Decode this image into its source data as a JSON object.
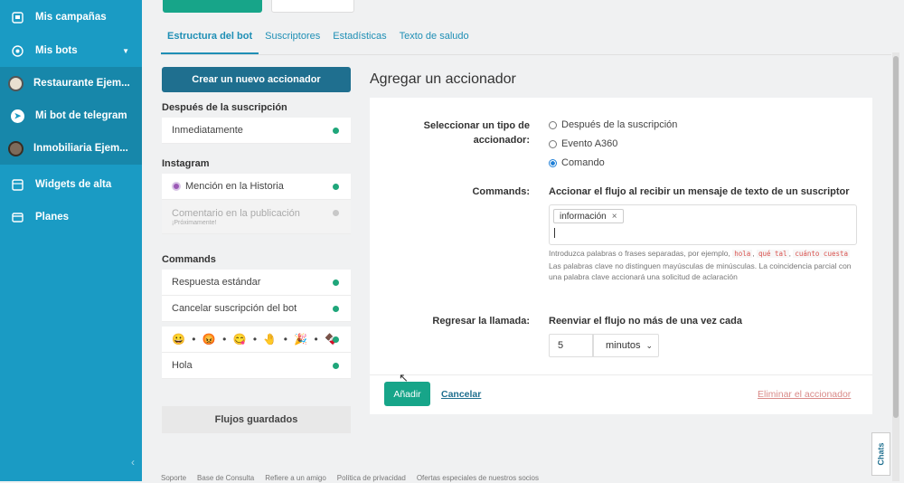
{
  "sidebar": {
    "items": [
      {
        "label": "Mis campañas",
        "icon": "campaigns-icon"
      },
      {
        "label": "Mis bots",
        "icon": "bot-icon"
      },
      {
        "label": "Restaurante Ejem...",
        "icon": "avatar"
      },
      {
        "label": "Mi bot de telegram",
        "icon": "telegram-icon"
      },
      {
        "label": "Inmobiliaria Ejem...",
        "icon": "avatar"
      },
      {
        "label": "Widgets de alta",
        "icon": "widgets-icon"
      },
      {
        "label": "Planes",
        "icon": "plans-icon"
      }
    ]
  },
  "tabs": [
    "Estructura del bot",
    "Suscriptores",
    "Estadísticas",
    "Texto de saludo"
  ],
  "left": {
    "create_label": "Crear un nuevo accionador",
    "sections": [
      {
        "title": "Después de la suscripción",
        "items": [
          "Inmediatamente"
        ]
      },
      {
        "title": "Instagram",
        "items": [
          "Mención en la Historia",
          "Comentario en la publicación",
          "¡Próximamente!"
        ]
      },
      {
        "title": "Commands",
        "items": [
          "Respuesta estándar",
          "Cancelar suscripción del bot",
          "😀 • 😡 • 😋 • 🤚 • 🎉 • 🍫",
          "Hola"
        ]
      }
    ],
    "flows_label": "Flujos guardados"
  },
  "panel": {
    "title": "Agregar un accionador",
    "trigger_type_label": "Seleccionar un tipo de accionador:",
    "options": [
      "Después de la suscripción",
      "Evento A360",
      "Comando"
    ],
    "selected_option": "Comando",
    "commands_label": "Commands:",
    "commands_desc": "Accionar el flujo al recibir un mensaje de texto de un suscriptor",
    "keyword_chip": "información",
    "help_1": "Introduzca palabras o frases separadas, por ejemplo,",
    "help_examples": [
      "hola",
      "qué tal",
      "cuánto cuesta"
    ],
    "help_2": "Las palabras clave no distinguen mayúsculas de minúsculas. La coincidencia parcial con una palabra clave accionará una solicitud de aclaración",
    "callback_label": "Regresar la llamada:",
    "callback_desc": "Reenviar el flujo no más de una vez cada",
    "interval_value": "5",
    "interval_unit": "minutos",
    "add_label": "Añadir",
    "cancel_label": "Cancelar",
    "delete_label": "Eliminar el accionador"
  },
  "chats_label": "Chats",
  "footer_links": [
    "Soporte",
    "Base de Consulta",
    "Refiere a un amigo",
    "Política de privacidad",
    "Ofertas especiales de nuestros socios"
  ]
}
